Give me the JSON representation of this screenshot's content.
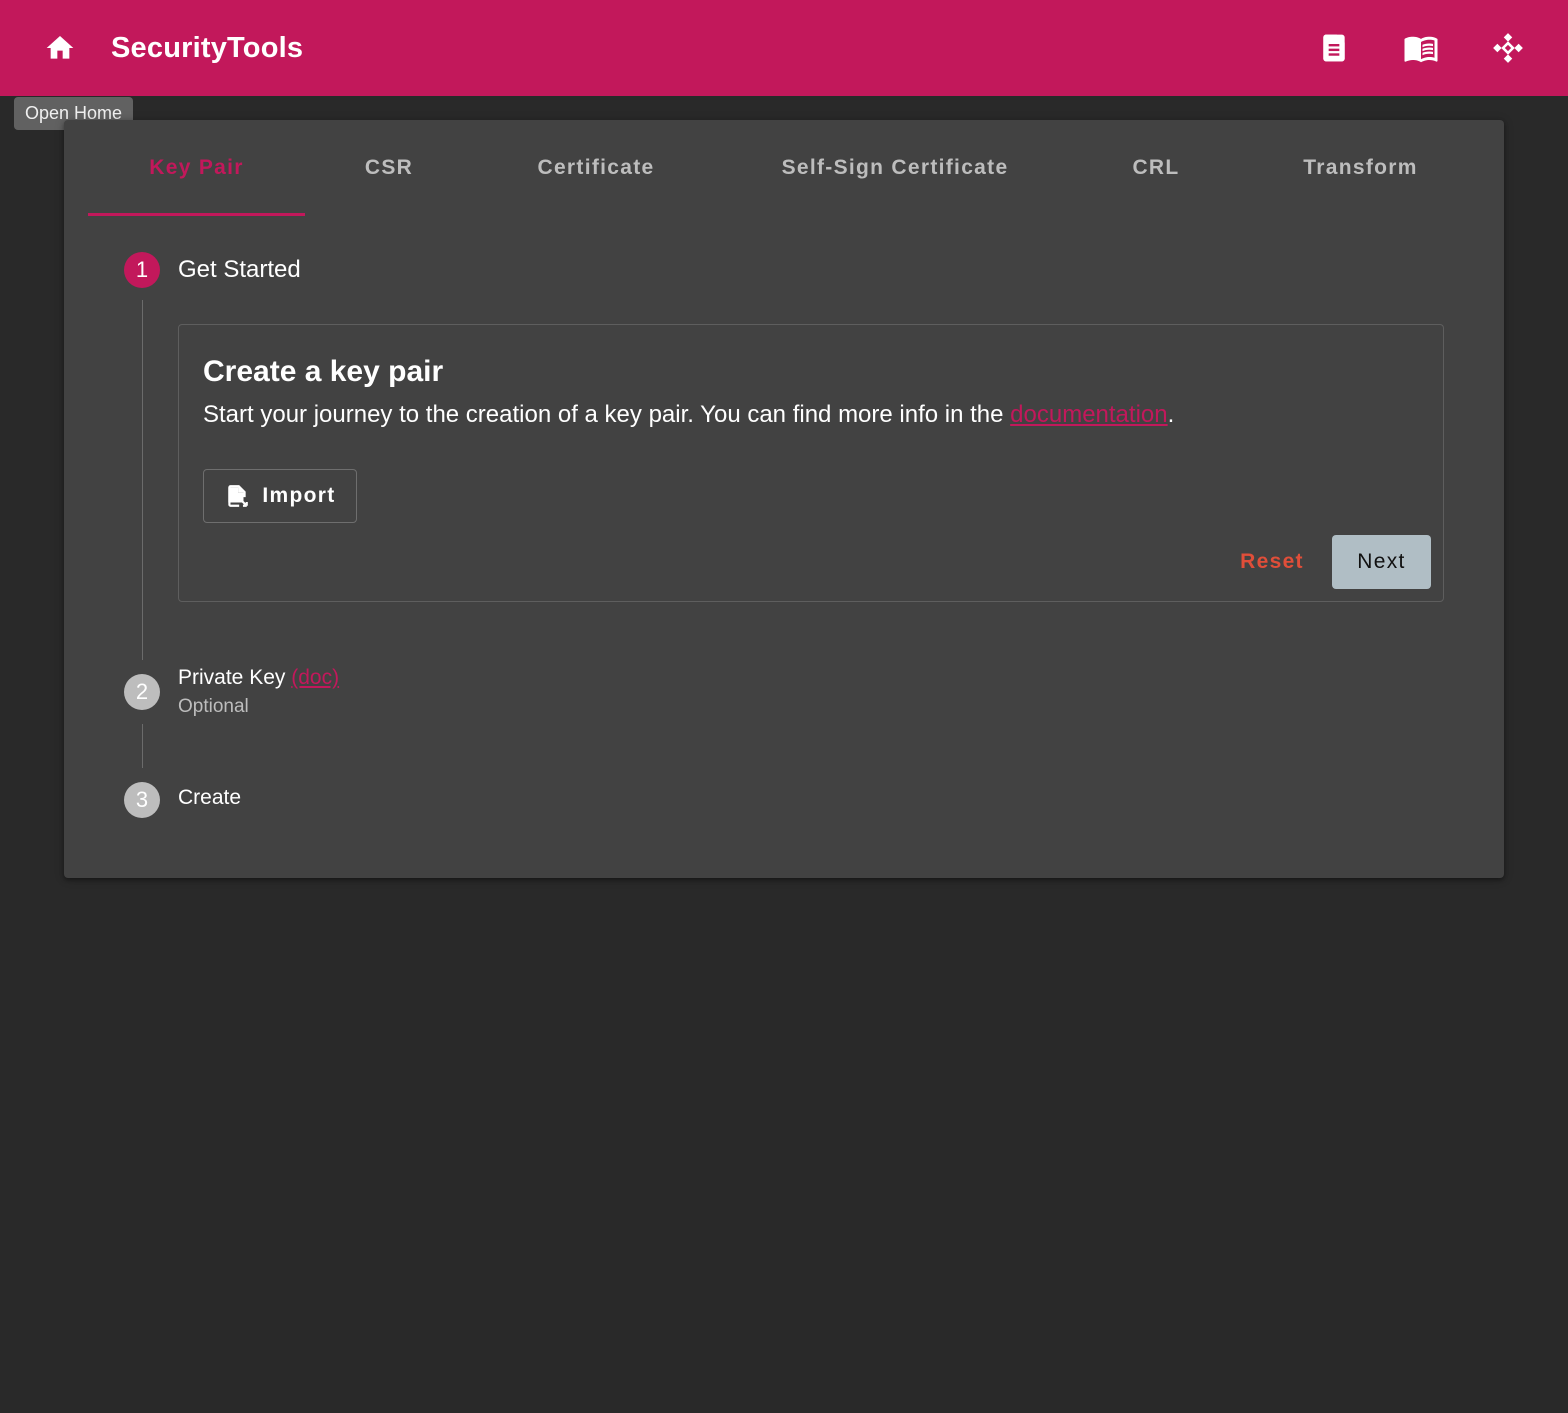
{
  "app": {
    "title": "SecurityTools",
    "home_tooltip": "Open Home"
  },
  "toolbar": {
    "icons": [
      "home-icon",
      "description-icon",
      "book-icon",
      "kubernetes-like-icon"
    ]
  },
  "tabs": [
    {
      "label": "Key Pair",
      "active": true
    },
    {
      "label": "CSR",
      "active": false
    },
    {
      "label": "Certificate",
      "active": false
    },
    {
      "label": "Self-Sign Certificate",
      "active": false
    },
    {
      "label": "CRL",
      "active": false
    },
    {
      "label": "Transform",
      "active": false
    }
  ],
  "stepper": {
    "steps": [
      {
        "number": "1",
        "title": "Get Started",
        "state": "active"
      },
      {
        "number": "2",
        "title": "Private Key",
        "link": "(doc)",
        "subtitle": "Optional",
        "state": "inactive"
      },
      {
        "number": "3",
        "title": "Create",
        "state": "inactive"
      }
    ]
  },
  "content": {
    "title": "Create a key pair",
    "description_before": "Start your journey to the creation of a key pair. You can find more info in the ",
    "description_link": "documentation",
    "description_after": ".",
    "import_label": "Import",
    "reset_label": "Reset",
    "next_label": "Next"
  },
  "colors": {
    "primary": "#c2185b",
    "background": "#292929",
    "card": "#424242",
    "reset": "#e04e39",
    "next_button": "#b0bec5",
    "inactive_step": "#bdbdbd"
  }
}
